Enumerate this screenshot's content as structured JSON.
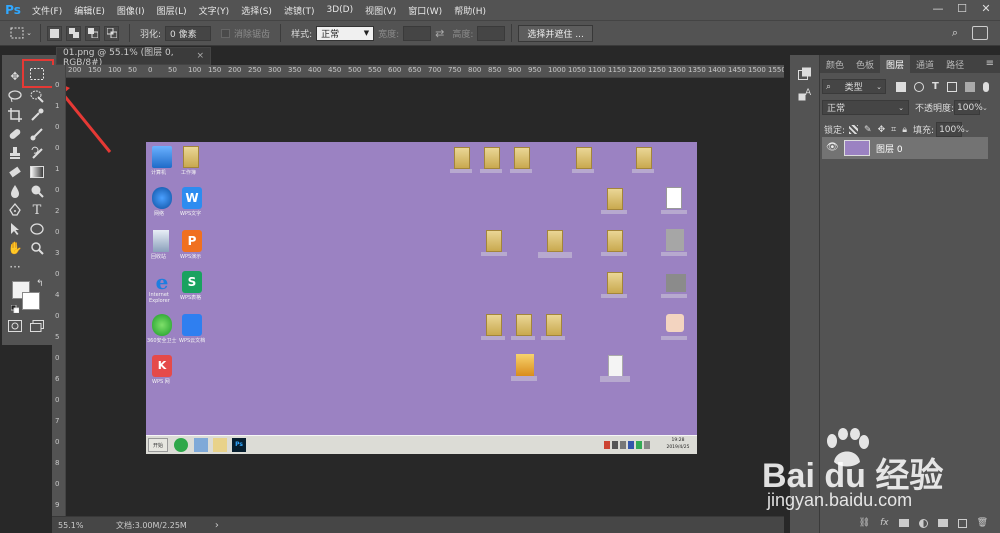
{
  "app": {
    "logo": "Ps"
  },
  "menu": [
    "文件(F)",
    "编辑(E)",
    "图像(I)",
    "图层(L)",
    "文字(Y)",
    "选择(S)",
    "滤镜(T)",
    "3D(D)",
    "视图(V)",
    "窗口(W)",
    "帮助(H)"
  ],
  "window_controls": {
    "minimize": "—",
    "maximize": "☐",
    "close": "✕"
  },
  "options": {
    "feather_label": "羽化:",
    "feather_value": "0 像素",
    "antialias_label": "消除锯齿",
    "style_label": "样式:",
    "style_value": "正常",
    "width_label": "宽度:",
    "height_label": "高度:",
    "select_mask_button": "选择并遮住 ..."
  },
  "document": {
    "tab_title": "01.png @ 55.1% (图层 0, RGB/8#)",
    "close": "×"
  },
  "ruler_top": [
    "200",
    "150",
    "100",
    "50",
    "0",
    "50",
    "100",
    "150",
    "200",
    "250",
    "300",
    "350",
    "400",
    "450",
    "500",
    "550",
    "600",
    "650",
    "700",
    "750",
    "800",
    "850",
    "900",
    "950",
    "1000",
    "1050",
    "1100",
    "1150",
    "1200",
    "1250",
    "1300",
    "1350",
    "1400",
    "1450",
    "1500",
    "1550"
  ],
  "ruler_left": [
    "0",
    "1",
    "0",
    "0",
    "1",
    "0",
    "2",
    "0",
    "3",
    "0",
    "4",
    "0",
    "5",
    "0",
    "6",
    "0",
    "7",
    "0",
    "8",
    "0",
    "9"
  ],
  "desktop": {
    "icons": [
      {
        "label": "计算机"
      },
      {
        "label": "工作簿"
      },
      {
        "label": "网络"
      },
      {
        "label": "WPS文字"
      },
      {
        "label": "回收站"
      },
      {
        "label": "WPS演示"
      },
      {
        "label": "Internet Explorer"
      },
      {
        "label": "WPS表格"
      },
      {
        "label": "360安全卫士"
      },
      {
        "label": "WPS云文档"
      },
      {
        "label": "WPS 网"
      }
    ],
    "taskbar": {
      "start": "开始",
      "clock_time": "19:28",
      "clock_date": "2019/4/25",
      "ps_button": "Ps"
    }
  },
  "status": {
    "zoom": "55.1%",
    "doc_info": "文档:3.00M/2.25M",
    "arrow": "›"
  },
  "panel": {
    "tabs": [
      "颜色",
      "色板",
      "图层",
      "通道",
      "路径"
    ],
    "active_tab": "图层",
    "filter_kind": "类型",
    "blend_mode": "正常",
    "opacity_label": "不透明度:",
    "opacity_value": "100%",
    "lock_label": "锁定:",
    "fill_label": "填充:",
    "fill_value": "100%",
    "layer_name": "图层 0",
    "footer_fx": "fx"
  },
  "watermark": {
    "brand": "Bai du 经验",
    "url": "jingyan.baidu.com"
  },
  "colors": {
    "highlight": "#e53935",
    "canvas_bg": "#9b82c2",
    "ps_blue": "#31a8ff"
  }
}
